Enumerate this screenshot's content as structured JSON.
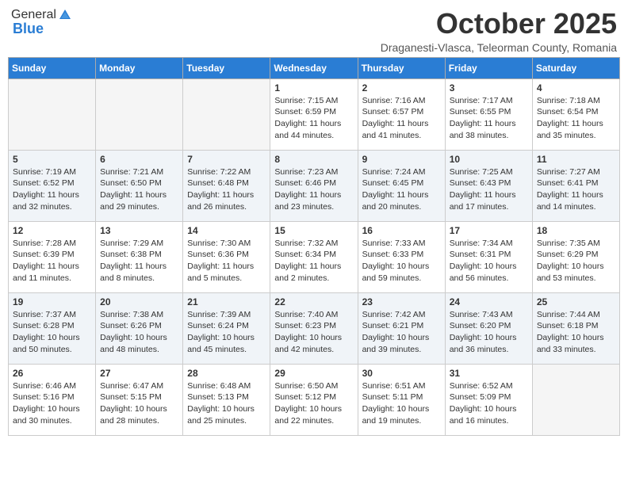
{
  "header": {
    "logo_general": "General",
    "logo_blue": "Blue",
    "month_title": "October 2025",
    "subtitle": "Draganesti-Vlasca, Teleorman County, Romania"
  },
  "weekdays": [
    "Sunday",
    "Monday",
    "Tuesday",
    "Wednesday",
    "Thursday",
    "Friday",
    "Saturday"
  ],
  "weeks": [
    [
      {
        "day": "",
        "info": ""
      },
      {
        "day": "",
        "info": ""
      },
      {
        "day": "",
        "info": ""
      },
      {
        "day": "1",
        "info": "Sunrise: 7:15 AM\nSunset: 6:59 PM\nDaylight: 11 hours\nand 44 minutes."
      },
      {
        "day": "2",
        "info": "Sunrise: 7:16 AM\nSunset: 6:57 PM\nDaylight: 11 hours\nand 41 minutes."
      },
      {
        "day": "3",
        "info": "Sunrise: 7:17 AM\nSunset: 6:55 PM\nDaylight: 11 hours\nand 38 minutes."
      },
      {
        "day": "4",
        "info": "Sunrise: 7:18 AM\nSunset: 6:54 PM\nDaylight: 11 hours\nand 35 minutes."
      }
    ],
    [
      {
        "day": "5",
        "info": "Sunrise: 7:19 AM\nSunset: 6:52 PM\nDaylight: 11 hours\nand 32 minutes."
      },
      {
        "day": "6",
        "info": "Sunrise: 7:21 AM\nSunset: 6:50 PM\nDaylight: 11 hours\nand 29 minutes."
      },
      {
        "day": "7",
        "info": "Sunrise: 7:22 AM\nSunset: 6:48 PM\nDaylight: 11 hours\nand 26 minutes."
      },
      {
        "day": "8",
        "info": "Sunrise: 7:23 AM\nSunset: 6:46 PM\nDaylight: 11 hours\nand 23 minutes."
      },
      {
        "day": "9",
        "info": "Sunrise: 7:24 AM\nSunset: 6:45 PM\nDaylight: 11 hours\nand 20 minutes."
      },
      {
        "day": "10",
        "info": "Sunrise: 7:25 AM\nSunset: 6:43 PM\nDaylight: 11 hours\nand 17 minutes."
      },
      {
        "day": "11",
        "info": "Sunrise: 7:27 AM\nSunset: 6:41 PM\nDaylight: 11 hours\nand 14 minutes."
      }
    ],
    [
      {
        "day": "12",
        "info": "Sunrise: 7:28 AM\nSunset: 6:39 PM\nDaylight: 11 hours\nand 11 minutes."
      },
      {
        "day": "13",
        "info": "Sunrise: 7:29 AM\nSunset: 6:38 PM\nDaylight: 11 hours\nand 8 minutes."
      },
      {
        "day": "14",
        "info": "Sunrise: 7:30 AM\nSunset: 6:36 PM\nDaylight: 11 hours\nand 5 minutes."
      },
      {
        "day": "15",
        "info": "Sunrise: 7:32 AM\nSunset: 6:34 PM\nDaylight: 11 hours\nand 2 minutes."
      },
      {
        "day": "16",
        "info": "Sunrise: 7:33 AM\nSunset: 6:33 PM\nDaylight: 10 hours\nand 59 minutes."
      },
      {
        "day": "17",
        "info": "Sunrise: 7:34 AM\nSunset: 6:31 PM\nDaylight: 10 hours\nand 56 minutes."
      },
      {
        "day": "18",
        "info": "Sunrise: 7:35 AM\nSunset: 6:29 PM\nDaylight: 10 hours\nand 53 minutes."
      }
    ],
    [
      {
        "day": "19",
        "info": "Sunrise: 7:37 AM\nSunset: 6:28 PM\nDaylight: 10 hours\nand 50 minutes."
      },
      {
        "day": "20",
        "info": "Sunrise: 7:38 AM\nSunset: 6:26 PM\nDaylight: 10 hours\nand 48 minutes."
      },
      {
        "day": "21",
        "info": "Sunrise: 7:39 AM\nSunset: 6:24 PM\nDaylight: 10 hours\nand 45 minutes."
      },
      {
        "day": "22",
        "info": "Sunrise: 7:40 AM\nSunset: 6:23 PM\nDaylight: 10 hours\nand 42 minutes."
      },
      {
        "day": "23",
        "info": "Sunrise: 7:42 AM\nSunset: 6:21 PM\nDaylight: 10 hours\nand 39 minutes."
      },
      {
        "day": "24",
        "info": "Sunrise: 7:43 AM\nSunset: 6:20 PM\nDaylight: 10 hours\nand 36 minutes."
      },
      {
        "day": "25",
        "info": "Sunrise: 7:44 AM\nSunset: 6:18 PM\nDaylight: 10 hours\nand 33 minutes."
      }
    ],
    [
      {
        "day": "26",
        "info": "Sunrise: 6:46 AM\nSunset: 5:16 PM\nDaylight: 10 hours\nand 30 minutes."
      },
      {
        "day": "27",
        "info": "Sunrise: 6:47 AM\nSunset: 5:15 PM\nDaylight: 10 hours\nand 28 minutes."
      },
      {
        "day": "28",
        "info": "Sunrise: 6:48 AM\nSunset: 5:13 PM\nDaylight: 10 hours\nand 25 minutes."
      },
      {
        "day": "29",
        "info": "Sunrise: 6:50 AM\nSunset: 5:12 PM\nDaylight: 10 hours\nand 22 minutes."
      },
      {
        "day": "30",
        "info": "Sunrise: 6:51 AM\nSunset: 5:11 PM\nDaylight: 10 hours\nand 19 minutes."
      },
      {
        "day": "31",
        "info": "Sunrise: 6:52 AM\nSunset: 5:09 PM\nDaylight: 10 hours\nand 16 minutes."
      },
      {
        "day": "",
        "info": ""
      }
    ]
  ]
}
